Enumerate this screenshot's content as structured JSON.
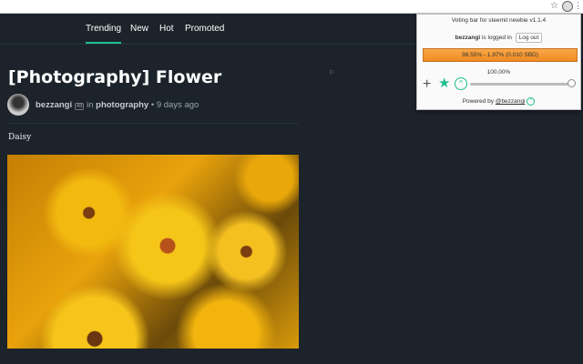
{
  "nav": {
    "items": [
      "Trending",
      "New",
      "Hot",
      "Promoted"
    ]
  },
  "post": {
    "title": "[Photography] Flower",
    "author": "bezzangi",
    "reputation": "48",
    "in_label": "in",
    "category": "photography",
    "age": "9 days ago",
    "body": "Daisy"
  },
  "popup": {
    "title": "Voting bar for steemit newbie v1.1.4",
    "user": "bezzangi",
    "logged_in_text": "is logged in",
    "logout": "Log out",
    "voting_power": "98.55% - 1.97% (0.010 SBD)",
    "weight": "100.00%",
    "weight_value": 100,
    "powered_by": "Powered by",
    "powered_user": "@bezzangi"
  },
  "icons": {
    "up": "^",
    "plus": "+",
    "star": "★",
    "bookmark": "☆",
    "flag": "⚐"
  },
  "colors": {
    "accent": "#1fbf8f",
    "bar": "#f08a20",
    "background": "#1c232b"
  }
}
